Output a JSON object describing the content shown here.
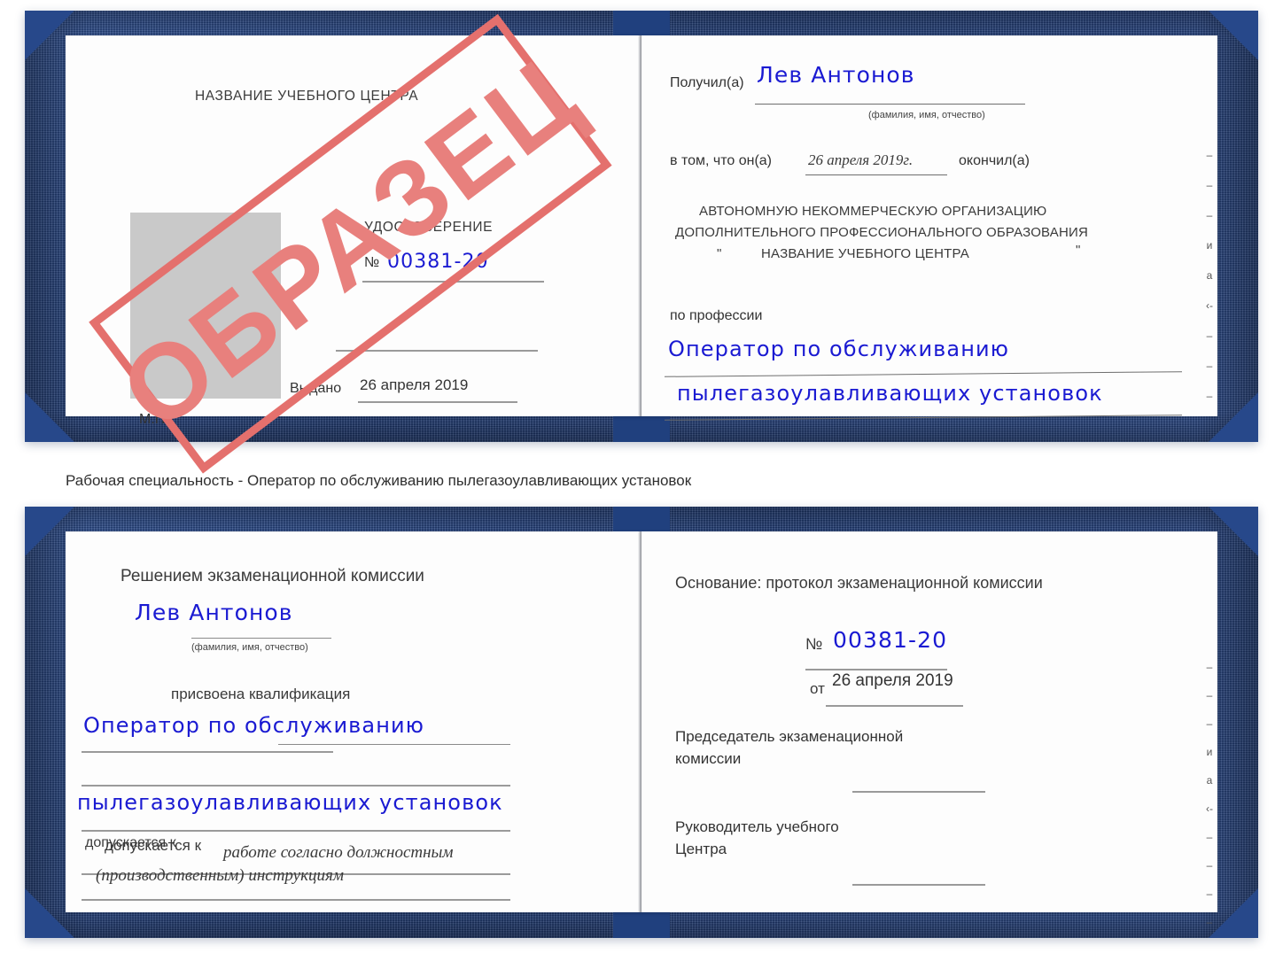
{
  "colors": {
    "cover_blue": "#27488a",
    "paper_white": "#fdfdfd",
    "ink_blue": "#1a1ad2",
    "stamp_red": "#e4706d",
    "photo_grey": "#c9c9c9",
    "rule_grey": "#9a9a9a"
  },
  "caption": {
    "text": "Рабочая специальность - Оператор по обслуживанию пылегазоулавливающих установок"
  },
  "stamp": {
    "text": "ОБРАЗЕЦ"
  },
  "certificate_front": {
    "left_page": {
      "center_name": "НАЗВАНИЕ УЧЕБНОГО ЦЕНТРА",
      "doc_type": "УДОСТОВЕРЕНИЕ",
      "number_label": "№",
      "number_value": "00381-20",
      "issued_label": "Выдано",
      "issued_value": "26 апреля 2019",
      "seal_label": "М.П."
    },
    "right_page": {
      "received_label": "Получил(а)",
      "received_value": "Лев Антонов",
      "received_hint": "(фамилия, имя, отчество)",
      "that_he_label": "в том, что он(а)",
      "that_he_value": "26 апреля 2019г.",
      "finished_label": "окончил(а)",
      "org_line1": "АВТОНОМНУЮ НЕКОММЕРЧЕСКУЮ ОРГАНИЗАЦИЮ",
      "org_line2": "ДОПОЛНИТЕЛЬНОГО ПРОФЕССИОНАЛЬНОГО ОБРАЗОВАНИЯ",
      "org_quote_open": "\"",
      "org_line3": "НАЗВАНИЕ УЧЕБНОГО ЦЕНТРА",
      "org_quote_close": "\"",
      "profession_label": "по профессии",
      "profession_line1": "Оператор по обслуживанию",
      "profession_line2": "пылегазоулавливающих установок",
      "edge_marks": [
        "–",
        "–",
        "–",
        "и",
        "а",
        "‹-",
        "–",
        "–",
        "–"
      ]
    }
  },
  "certificate_inner": {
    "left_page": {
      "decision_title": "Решением экзаменационной комиссии",
      "name_value": "Лев Антонов",
      "name_hint": "(фамилия, имя, отчество)",
      "qualification_label": "присвоена квалификация",
      "qualification_line1": "Оператор по обслуживанию",
      "qualification_line2": "пылегазоулавливающих установок",
      "admitted_label": "допускается к",
      "admitted_value_line1": "работе согласно должностным",
      "admitted_value_line2": "(производственным) инструкциям"
    },
    "right_page": {
      "basis_label": "Основание: протокол экзаменационной комиссии",
      "number_label": "№",
      "number_value": "00381-20",
      "date_label": "от",
      "date_value": "26 апреля 2019",
      "chairman_line1": "Председатель экзаменационной",
      "chairman_line2": "комиссии",
      "head_line1": "Руководитель учебного",
      "head_line2": "Центра",
      "edge_marks": [
        "–",
        "–",
        "–",
        "и",
        "а",
        "‹-",
        "–",
        "–",
        "–",
        "–"
      ]
    }
  }
}
